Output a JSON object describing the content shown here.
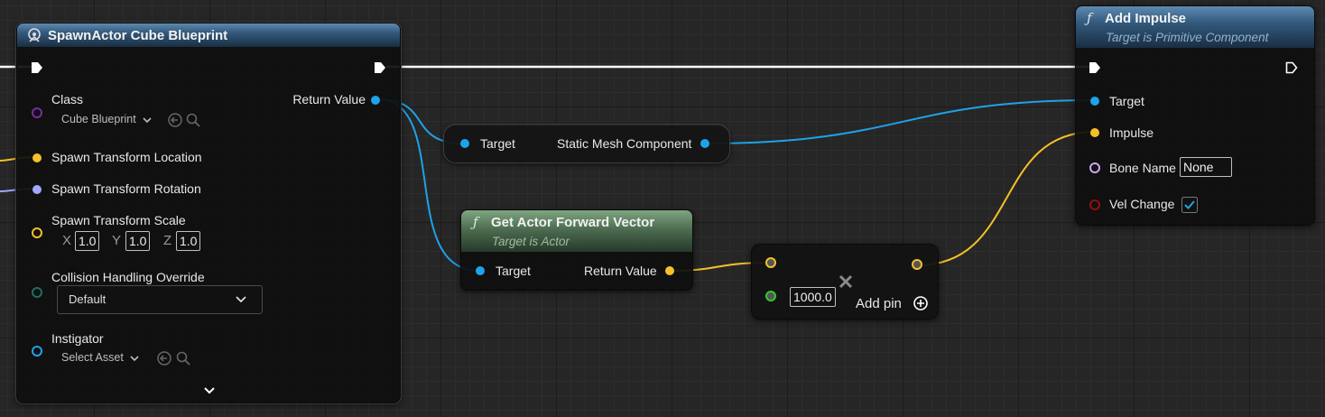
{
  "spawn_node": {
    "title": "SpawnActor Cube Blueprint",
    "pins": {
      "class": "Class",
      "class_value": "Cube Blueprint",
      "location": "Spawn Transform Location",
      "rotation": "Spawn Transform Rotation",
      "scale": "Spawn Transform Scale",
      "scale_x_label": "X",
      "scale_x": "1.0",
      "scale_y_label": "Y",
      "scale_y": "1.0",
      "scale_z_label": "Z",
      "scale_z": "1.0",
      "collision": "Collision Handling Override",
      "collision_value": "Default",
      "instigator": "Instigator",
      "instigator_value": "Select Asset",
      "return_value": "Return Value"
    }
  },
  "static_mesh_node": {
    "target": "Target",
    "output": "Static Mesh Component"
  },
  "forward_node": {
    "title": "Get Actor Forward Vector",
    "subtitle": "Target is Actor",
    "target": "Target",
    "return_value": "Return Value"
  },
  "multiply_node": {
    "value": "1000.0",
    "add_pin": "Add pin"
  },
  "impulse_node": {
    "title": "Add Impulse",
    "subtitle": "Target is Primitive Component",
    "target": "Target",
    "impulse": "Impulse",
    "bone_name": "Bone Name",
    "bone_name_value": "None",
    "vel_change": "Vel Change",
    "vel_change_checked": true
  },
  "colors": {
    "exec": "#ffffff",
    "object": "#1fa2e8",
    "vector": "#f5c02a",
    "rotator": "#a0a8ff",
    "class": "#7a2aa8",
    "enum": "#1f6e62",
    "name": "#c9a8f0",
    "bool": "#8f1010",
    "float": "#32c832"
  },
  "icons": [
    "function-icon",
    "spawn-icon",
    "chevron-down-icon",
    "back-arrow-icon",
    "search-icon",
    "plus-circle-icon",
    "close-icon",
    "checkbox-icon"
  ]
}
